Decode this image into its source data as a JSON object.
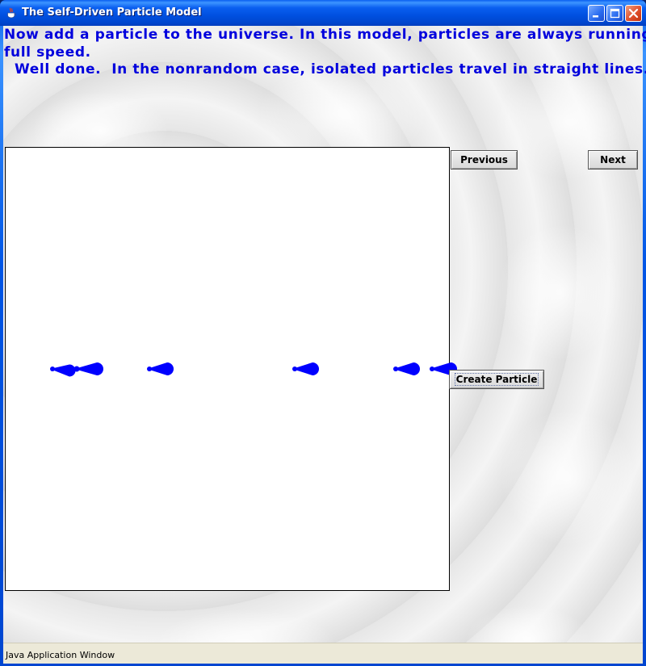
{
  "window": {
    "title": "The Self-Driven Particle Model",
    "app_icon": "java-cup-icon"
  },
  "titlebar_buttons": {
    "minimize_icon": "minimize-icon",
    "maximize_icon": "maximize-icon",
    "close_icon": "close-icon"
  },
  "instructions": {
    "line1": "Now add a particle to the universe.  In this model, particles are always running at",
    "line2": "full speed.",
    "line3": "  Well done.  In the nonrandom case, isolated particles travel in straight lines."
  },
  "controls": {
    "previous_label": "Previous",
    "next_label": "Next",
    "create_particle_label": "Create Particle"
  },
  "simulation": {
    "particle_color": "#0000ff",
    "canvas_background": "#ffffff",
    "particle_count": 6,
    "heading": "right"
  },
  "status": {
    "text": "Java Application Window"
  },
  "colors": {
    "instruction_text": "#0000dd",
    "titlebar": "#0a5ff0",
    "statusbar": "#ece9d8"
  }
}
